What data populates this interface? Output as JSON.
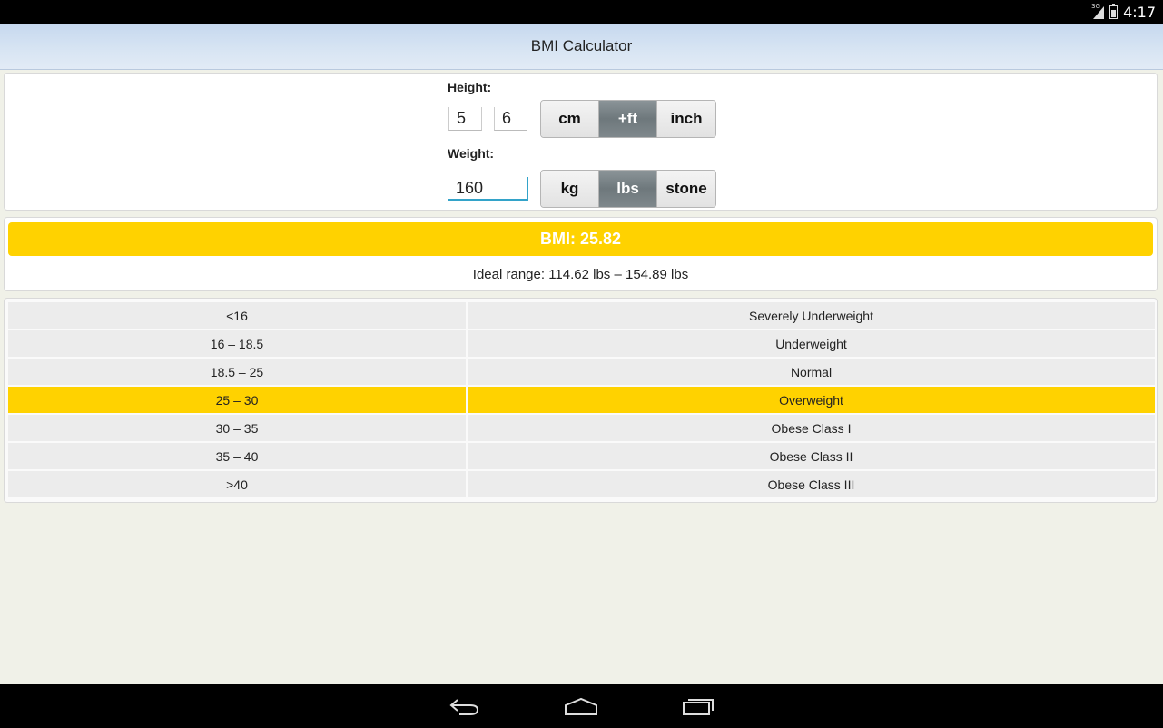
{
  "status_bar": {
    "network": "3G",
    "time": "4:17"
  },
  "title": "BMI Calculator",
  "height": {
    "label": "Height:",
    "feet_value": "5",
    "inches_value": "6",
    "units": [
      "cm",
      "+ft",
      "inch"
    ],
    "selected_unit": "+ft"
  },
  "weight": {
    "label": "Weight:",
    "value": "160",
    "units": [
      "kg",
      "lbs",
      "stone"
    ],
    "selected_unit": "lbs"
  },
  "result": {
    "bmi_text": "BMI: 25.82",
    "ideal_range_text": "Ideal range: 114.62 lbs – 154.89 lbs",
    "accent_color": "#ffd200"
  },
  "table": {
    "rows": [
      {
        "range": "<16",
        "category": "Severely Underweight",
        "highlighted": false
      },
      {
        "range": "16 – 18.5",
        "category": "Underweight",
        "highlighted": false
      },
      {
        "range": "18.5 – 25",
        "category": "Normal",
        "highlighted": false
      },
      {
        "range": "25 – 30",
        "category": "Overweight",
        "highlighted": true
      },
      {
        "range": "30 – 35",
        "category": "Obese Class I",
        "highlighted": false
      },
      {
        "range": "35 – 40",
        "category": "Obese Class II",
        "highlighted": false
      },
      {
        "range": ">40",
        "category": "Obese Class III",
        "highlighted": false
      }
    ]
  },
  "nav_bar": {
    "icons": [
      "back-icon",
      "home-icon",
      "recent-apps-icon"
    ]
  }
}
